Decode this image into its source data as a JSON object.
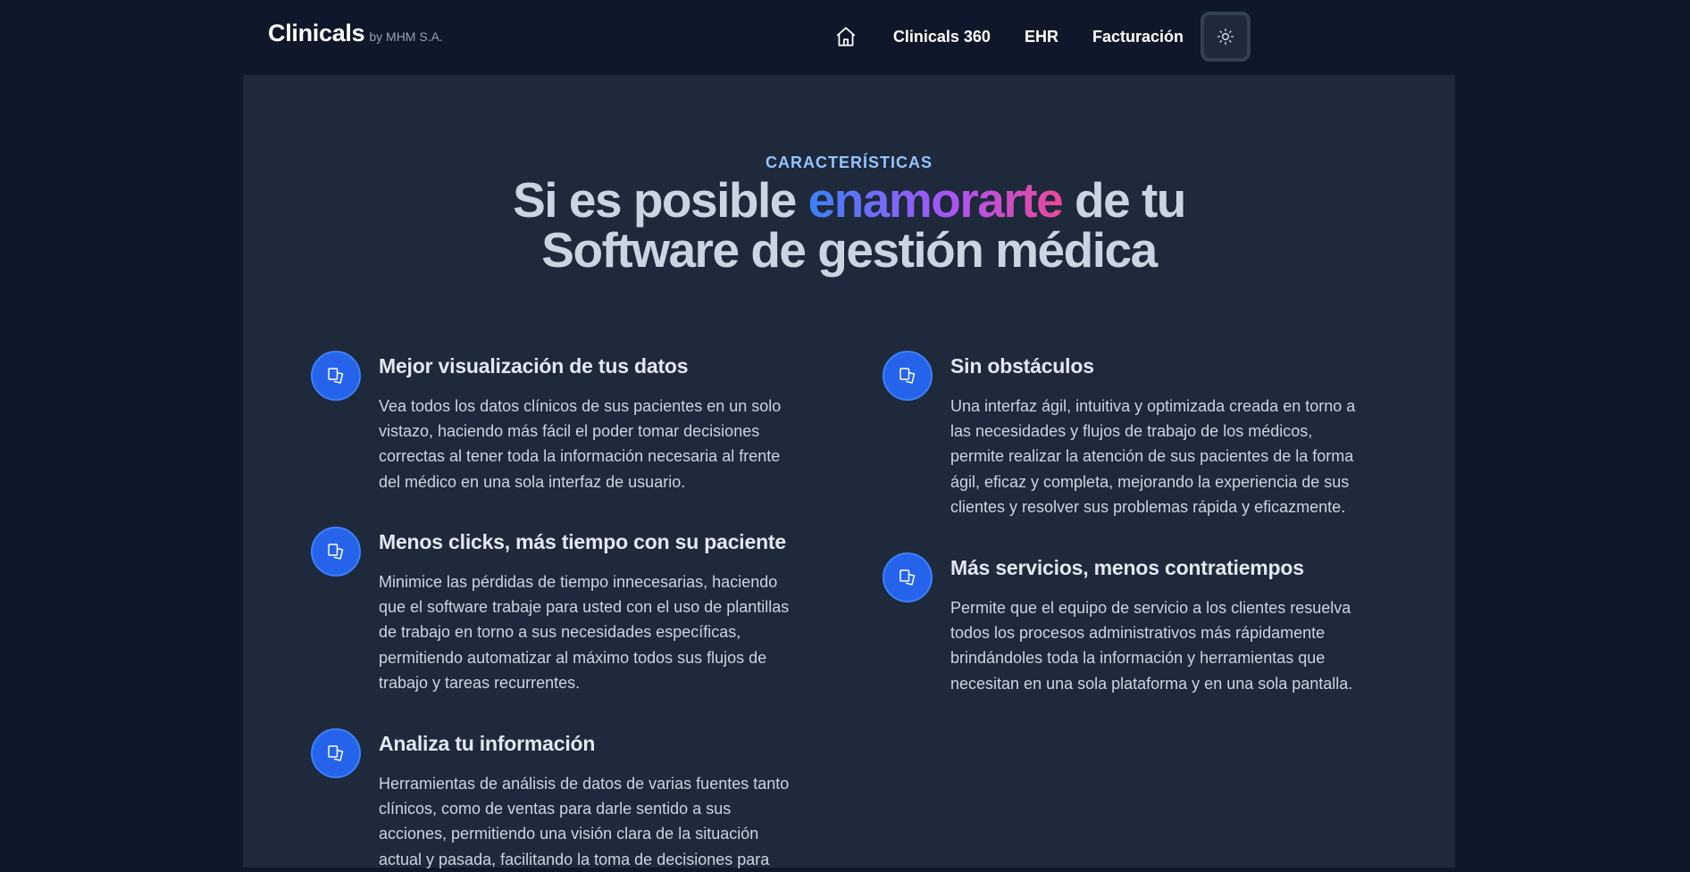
{
  "header": {
    "brand": "Clinicals",
    "brand_sub": "by MHM S.A.",
    "nav": [
      "Clinicals 360",
      "EHR",
      "Facturación"
    ]
  },
  "section": {
    "eyebrow": "CARACTERÍSTICAS",
    "headline_pre": "Si es posible ",
    "headline_highlight": "enamorarte",
    "headline_post": " de tu",
    "headline_line2": "Software de gestión médica"
  },
  "features": [
    {
      "title": "Mejor visualización de tus datos",
      "desc": "Vea todos los datos clínicos de sus pacientes en un solo vistazo, haciendo más fácil el poder tomar decisiones correctas al tener toda la información necesaria al frente del médico en una sola interfaz de usuario."
    },
    {
      "title": "Sin obstáculos",
      "desc": "Una interfaz ágil, intuitiva y optimizada creada en torno a las necesidades y flujos de trabajo de los médicos, permite realizar la atención de sus pacientes de la forma ágil, eficaz y completa, mejorando la experiencia de sus clientes y resolver sus problemas rápida y eficazmente."
    },
    {
      "title": "Menos clicks, más tiempo con su paciente",
      "desc": "Minimice las pérdidas de tiempo innecesarias, haciendo que el software trabaje para usted con el uso de plantillas de trabajo en torno a sus necesidades específicas, permitiendo automatizar al máximo todos sus flujos de trabajo y tareas recurrentes."
    },
    {
      "title": "Más servicios, menos contratiempos",
      "desc": "Permite que el equipo de servicio a los clientes resuelva todos los procesos administrativos más rápidamente brindándoles toda la información y herramientas que necesitan en una sola plataforma y en una sola pantalla."
    },
    {
      "title": "Analiza tu información",
      "desc": "Herramientas de análisis de datos de varias fuentes tanto clínicos, como de ventas para darle sentido a sus acciones, permitiendo una visión clara de la situación actual y pasada, facilitando la toma de decisiones para"
    }
  ],
  "colors": {
    "page_bg": "#0f172a",
    "section_bg": "#1e293b",
    "accent": "#2563eb",
    "eyebrow": "#93c5fd",
    "gradient": [
      "#3b82f6",
      "#a855f7",
      "#ec4899"
    ]
  },
  "icons": {
    "home": "home-icon",
    "theme": "sun-icon",
    "feature": "copy-icon"
  }
}
